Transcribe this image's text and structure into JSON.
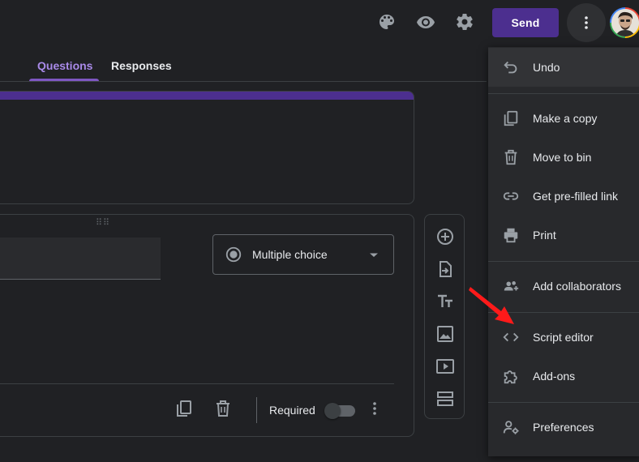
{
  "topbar": {
    "send_label": "Send",
    "icons": [
      "palette-icon",
      "eye-icon",
      "gear-icon",
      "more-vert-icon"
    ]
  },
  "tabs": [
    {
      "label": "Questions",
      "active": true
    },
    {
      "label": "Responses",
      "active": false
    }
  ],
  "question": {
    "type_label": "Multiple choice",
    "required_label": "Required",
    "required": false
  },
  "side_tools": [
    "add-question-icon",
    "import-questions-icon",
    "title-text-icon",
    "image-icon",
    "video-icon",
    "section-icon"
  ],
  "menu": {
    "items": [
      {
        "label": "Undo",
        "icon": "undo-icon"
      },
      {
        "label": "Make a copy",
        "icon": "copy-icon"
      },
      {
        "label": "Move to bin",
        "icon": "trash-icon"
      },
      {
        "label": "Get pre-filled link",
        "icon": "link-icon"
      },
      {
        "label": "Print",
        "icon": "print-icon"
      },
      {
        "label": "Add collaborators",
        "icon": "add-people-icon"
      },
      {
        "label": "Script editor",
        "icon": "code-icon"
      },
      {
        "label": "Add-ons",
        "icon": "puzzle-icon"
      },
      {
        "label": "Preferences",
        "icon": "person-settings-icon"
      }
    ]
  },
  "colors": {
    "background": "#202124",
    "accent": "#4c2f8f",
    "tab_active": "#a98ae8",
    "menu_bg": "#28292c",
    "annotation_arrow": "#ff1a1a"
  }
}
